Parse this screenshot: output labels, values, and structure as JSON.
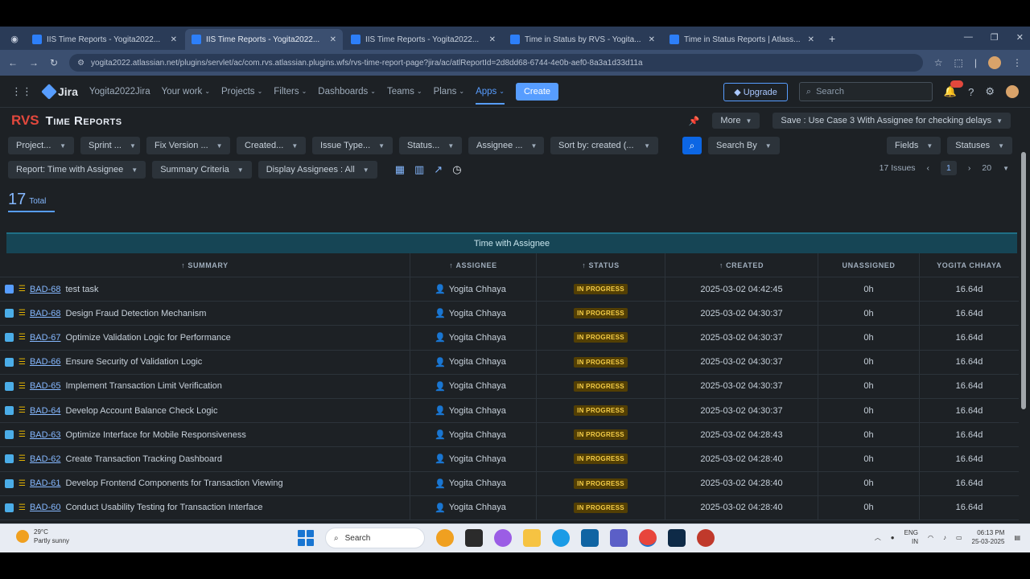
{
  "browser": {
    "tabs": [
      {
        "title": "IIS  Time Reports - Yogita2022...",
        "active": false
      },
      {
        "title": "IIS  Time Reports - Yogita2022...",
        "active": true
      },
      {
        "title": "IIS  Time Reports - Yogita2022...",
        "active": false
      },
      {
        "title": "Time in Status by RVS - Yogita...",
        "active": false
      },
      {
        "title": "Time in Status Reports | Atlass...",
        "active": false
      }
    ],
    "url": "yogita2022.atlassian.net/plugins/servlet/ac/com.rvs.atlassian.plugins.wfs/rvs-time-report-page?jira/ac/atlReportId=2d8dd68-6744-4e0b-aef0-8a3a1d33d11a"
  },
  "jira": {
    "logo": "Jira",
    "site": "Yogita2022Jira",
    "nav": [
      "Your work",
      "Projects",
      "Filters",
      "Dashboards",
      "Teams",
      "Plans",
      "Apps"
    ],
    "create": "Create",
    "upgrade": "Upgrade",
    "search_placeholder": "Search",
    "notif_count": "9+"
  },
  "app": {
    "logo": "RVS",
    "title": "Time Reports",
    "more": "More",
    "saved_view": "Save : Use Case 3 With Assignee for checking delays",
    "filters": [
      "Project...",
      "Sprint ...",
      "Fix Version ...",
      "Created...",
      "Issue Type...",
      "Status...",
      "Assignee ...",
      "Sort by: created (..."
    ],
    "search_by": "Search By",
    "fields": "Fields",
    "statuses": "Statuses",
    "report": "Report: Time with Assignee",
    "summary_criteria": "Summary Criteria",
    "display_assignees": "Display Assignees : All",
    "issues_count": "17 Issues",
    "page": "1",
    "page_size": "20",
    "total_num": "17",
    "total_label": "Total"
  },
  "table": {
    "banner": "Time with Assignee",
    "headers": [
      "SUMMARY",
      "ASSIGNEE",
      "STATUS",
      "CREATED",
      "UNASSIGNED",
      "YOGITA CHHAYA"
    ],
    "rows": [
      {
        "key": "BAD-68",
        "summary": "test task",
        "assignee": "Yogita Chhaya",
        "status": "IN PROGRESS",
        "created": "2025-03-02 04:42:45",
        "unassigned": "0h",
        "yc": "16.64d",
        "checked": true
      },
      {
        "key": "BAD-68",
        "summary": "Design Fraud Detection Mechanism",
        "assignee": "Yogita Chhaya",
        "status": "IN PROGRESS",
        "created": "2025-03-02 04:30:37",
        "unassigned": "0h",
        "yc": "16.64d",
        "checked": false
      },
      {
        "key": "BAD-67",
        "summary": "Optimize Validation Logic for Performance",
        "assignee": "Yogita Chhaya",
        "status": "IN PROGRESS",
        "created": "2025-03-02 04:30:37",
        "unassigned": "0h",
        "yc": "16.64d",
        "checked": false
      },
      {
        "key": "BAD-66",
        "summary": "Ensure Security of Validation Logic",
        "assignee": "Yogita Chhaya",
        "status": "IN PROGRESS",
        "created": "2025-03-02 04:30:37",
        "unassigned": "0h",
        "yc": "16.64d",
        "checked": false
      },
      {
        "key": "BAD-65",
        "summary": "Implement Transaction Limit Verification",
        "assignee": "Yogita Chhaya",
        "status": "IN PROGRESS",
        "created": "2025-03-02 04:30:37",
        "unassigned": "0h",
        "yc": "16.64d",
        "checked": false
      },
      {
        "key": "BAD-64",
        "summary": "Develop Account Balance Check Logic",
        "assignee": "Yogita Chhaya",
        "status": "IN PROGRESS",
        "created": "2025-03-02 04:30:37",
        "unassigned": "0h",
        "yc": "16.64d",
        "checked": false
      },
      {
        "key": "BAD-63",
        "summary": "Optimize Interface for Mobile Responsiveness",
        "assignee": "Yogita Chhaya",
        "status": "IN PROGRESS",
        "created": "2025-03-02 04:28:43",
        "unassigned": "0h",
        "yc": "16.64d",
        "checked": false
      },
      {
        "key": "BAD-62",
        "summary": "Create Transaction Tracking Dashboard",
        "assignee": "Yogita Chhaya",
        "status": "IN PROGRESS",
        "created": "2025-03-02 04:28:40",
        "unassigned": "0h",
        "yc": "16.64d",
        "checked": false
      },
      {
        "key": "BAD-61",
        "summary": "Develop Frontend Components for Transaction Viewing",
        "assignee": "Yogita Chhaya",
        "status": "IN PROGRESS",
        "created": "2025-03-02 04:28:40",
        "unassigned": "0h",
        "yc": "16.64d",
        "checked": false
      },
      {
        "key": "BAD-60",
        "summary": "Conduct Usability Testing for Transaction Interface",
        "assignee": "Yogita Chhaya",
        "status": "IN PROGRESS",
        "created": "2025-03-02 04:28:40",
        "unassigned": "0h",
        "yc": "16.64d",
        "checked": false
      }
    ]
  },
  "taskbar": {
    "temp": "29°C",
    "weather": "Partly sunny",
    "search": "Search",
    "lang1": "ENG",
    "lang2": "IN",
    "time": "06:13 PM",
    "date": "25-03-2025"
  },
  "colors": {
    "accent": "#579dff",
    "status_bg": "#533f04",
    "status_fg": "#f5cd47",
    "banner": "#164555"
  }
}
